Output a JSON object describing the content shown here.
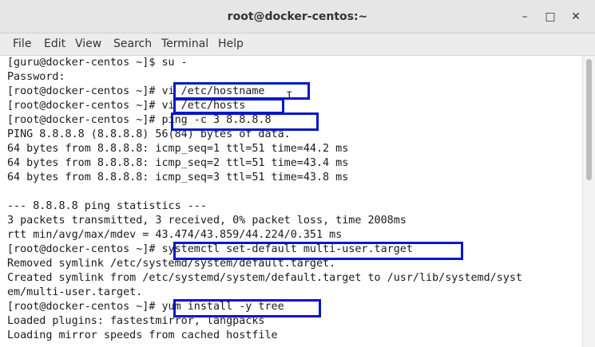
{
  "window": {
    "title": "root@docker-centos:~",
    "minimize_glyph": "–",
    "maximize_glyph": "□",
    "close_glyph": "✕"
  },
  "menu": [
    "File",
    "Edit",
    "View",
    "Search",
    "Terminal",
    "Help"
  ],
  "terminal_lines": [
    "[guru@docker-centos ~]$ su -",
    "Password:",
    "[root@docker-centos ~]# vi /etc/hostname",
    "[root@docker-centos ~]# vi /etc/hosts",
    "[root@docker-centos ~]# ping -c 3 8.8.8.8",
    "PING 8.8.8.8 (8.8.8.8) 56(84) bytes of data.",
    "64 bytes from 8.8.8.8: icmp_seq=1 ttl=51 time=44.2 ms",
    "64 bytes from 8.8.8.8: icmp_seq=2 ttl=51 time=43.4 ms",
    "64 bytes from 8.8.8.8: icmp_seq=3 ttl=51 time=43.8 ms",
    "",
    "--- 8.8.8.8 ping statistics ---",
    "3 packets transmitted, 3 received, 0% packet loss, time 2008ms",
    "rtt min/avg/max/mdev = 43.474/43.859/44.224/0.351 ms",
    "[root@docker-centos ~]# systemctl set-default multi-user.target",
    "Removed symlink /etc/systemd/system/default.target.",
    "Created symlink from /etc/systemd/system/default.target to /usr/lib/systemd/syst",
    "em/multi-user.target.",
    "[root@docker-centos ~]# yum install -y tree",
    "Loaded plugins: fastestmirror, langpacks",
    "Loading mirror speeds from cached hostfile"
  ],
  "colors": {
    "highlight_box": "#0018c8",
    "terminal_bg": "#ffffff",
    "terminal_fg": "#1a1a1a"
  },
  "icons": {
    "text_cursor": "I"
  }
}
